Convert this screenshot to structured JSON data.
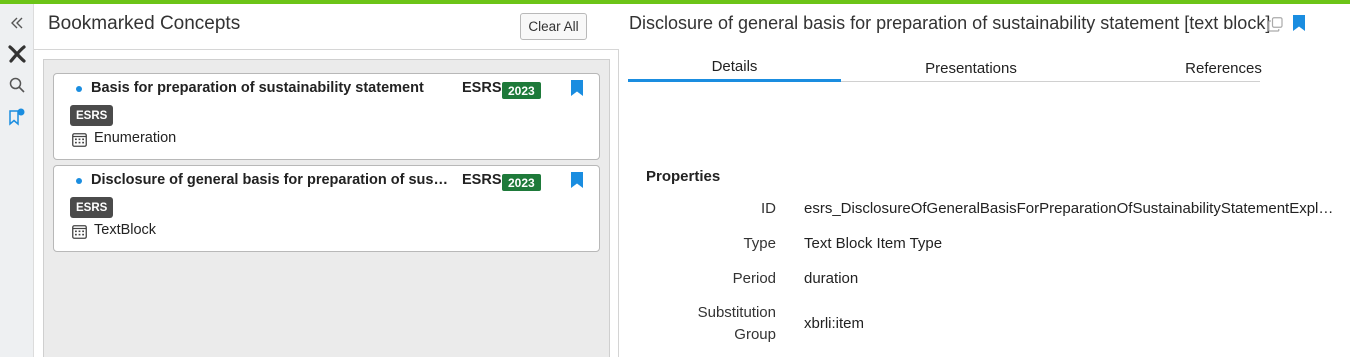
{
  "colors": {
    "accent_bar": "#6cc417",
    "bookmark_blue": "#1a8de0",
    "year_badge": "#1e7a3a",
    "tag_badge": "#4b4b4b"
  },
  "rail": {
    "icons": [
      "double-chevron-left-icon",
      "xbrl-x-icon",
      "search-icon",
      "bookmark-notification-icon"
    ]
  },
  "bookmarks": {
    "title": "Bookmarked Concepts",
    "clear_label": "Clear All",
    "items": [
      {
        "name": "Basis for preparation of sustainability statement",
        "taxonomy": "ESRS",
        "year": "2023",
        "tag": "ESRS",
        "type": "Enumeration",
        "type_icon": "calendar-grid-icon",
        "bookmarked": true
      },
      {
        "name": "Disclosure of general basis for preparation of sustainability statement",
        "taxonomy": "ESRS",
        "year": "2023",
        "tag": "ESRS",
        "type": "TextBlock",
        "type_icon": "calendar-grid-icon",
        "bookmarked": true
      }
    ]
  },
  "detail": {
    "title": "Disclosure of general basis for preparation of sustainability statement [text block]",
    "tabs": [
      "Details",
      "Presentations",
      "References"
    ],
    "active_tab": "Details",
    "properties_title": "Properties",
    "properties": [
      {
        "label": "ID",
        "value": "esrs_DisclosureOfGeneralBasisForPreparationOfSustainabilityStatementExplanatory"
      },
      {
        "label": "Type",
        "value": "Text Block Item Type"
      },
      {
        "label": "Period",
        "value": "duration"
      },
      {
        "label": "Substitution Group",
        "value": "xbrli:item"
      }
    ]
  }
}
